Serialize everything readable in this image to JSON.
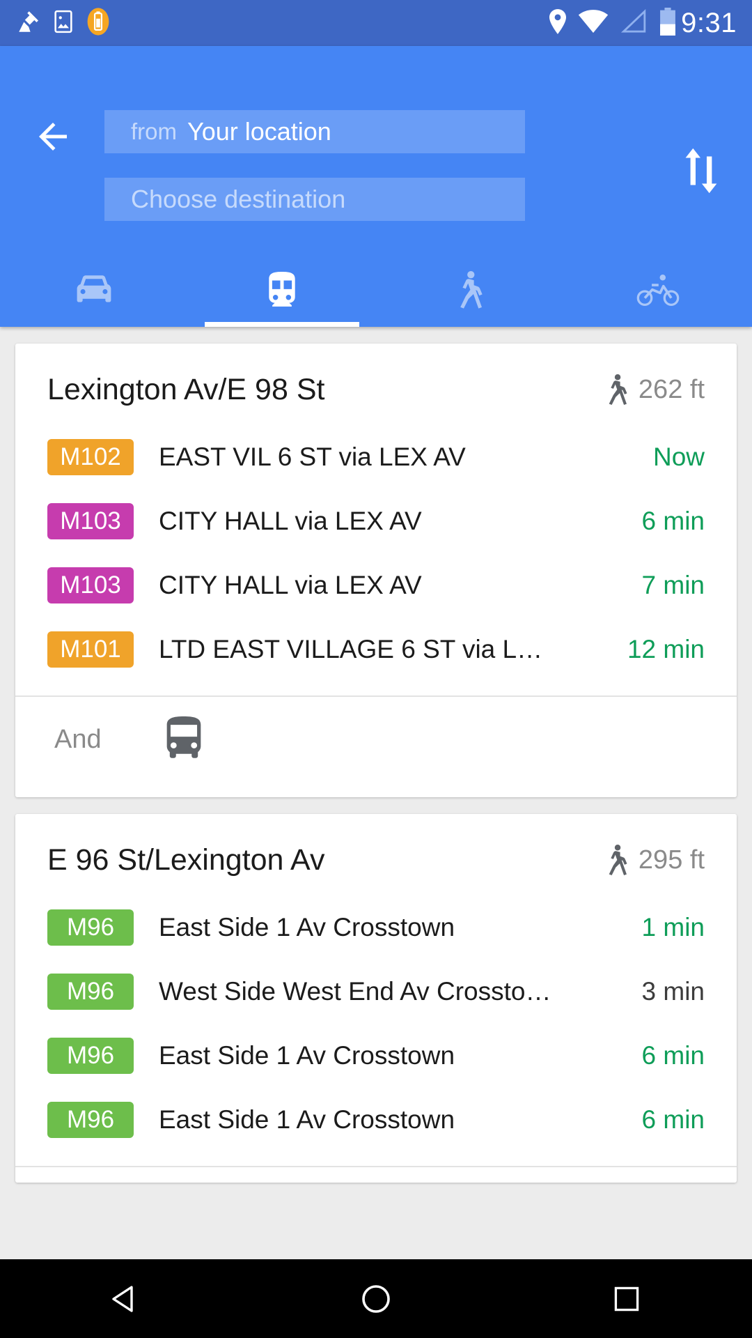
{
  "status_bar": {
    "time": "9:31",
    "left_icons": [
      "cleaner-icon",
      "screenshot-image-icon",
      "battery-saver-icon"
    ],
    "right_icons": [
      "location-pin-icon",
      "wifi-icon",
      "cell-signal-icon",
      "battery-icon"
    ]
  },
  "header": {
    "back_label": "back-arrow",
    "origin": {
      "prefix": "from",
      "value": "Your location"
    },
    "destination": {
      "placeholder": "Choose destination"
    },
    "swap_label": "swap-endpoints",
    "accent_color": "#4585F4",
    "tabs": [
      {
        "id": "driving",
        "icon": "car-icon",
        "active": false
      },
      {
        "id": "transit",
        "icon": "transit-train-icon",
        "active": true
      },
      {
        "id": "walking",
        "icon": "walking-person-icon",
        "active": false
      },
      {
        "id": "cycling",
        "icon": "bicycle-icon",
        "active": false
      }
    ]
  },
  "colors": {
    "badge_orange": "#F0A32A",
    "badge_magenta": "#C63CAE",
    "badge_green": "#6DBE4B",
    "eta_green": "#0E9D58",
    "status_bar": "#3E67C4"
  },
  "cards": [
    {
      "stop_name": "Lexington Av/E 98 St",
      "walk_icon": "walking-person-icon",
      "walk_distance": "262 ft",
      "routes": [
        {
          "badge": "M102",
          "badge_color": "#F0A32A",
          "headsign": "EAST VIL 6 ST via LEX AV",
          "eta": "Now",
          "eta_muted": false
        },
        {
          "badge": "M103",
          "badge_color": "#C63CAE",
          "headsign": "CITY HALL via LEX AV",
          "eta": "6 min",
          "eta_muted": false
        },
        {
          "badge": "M103",
          "badge_color": "#C63CAE",
          "headsign": "CITY HALL via LEX AV",
          "eta": "7 min",
          "eta_muted": false
        },
        {
          "badge": "M101",
          "badge_color": "#F0A32A",
          "headsign": "LTD EAST VILLAGE 6 ST via L…",
          "eta": "12 min",
          "eta_muted": false
        }
      ],
      "and_row": {
        "label": "And",
        "icon": "bus-icon"
      }
    },
    {
      "stop_name": "E 96 St/Lexington Av",
      "walk_icon": "walking-person-icon",
      "walk_distance": "295 ft",
      "routes": [
        {
          "badge": "M96",
          "badge_color": "#6DBE4B",
          "headsign": "East Side 1 Av Crosstown",
          "eta": "1 min",
          "eta_muted": false
        },
        {
          "badge": "M96",
          "badge_color": "#6DBE4B",
          "headsign": "West Side West End Av Crossto…",
          "eta": "3 min",
          "eta_muted": true
        },
        {
          "badge": "M96",
          "badge_color": "#6DBE4B",
          "headsign": "East Side 1 Av Crosstown",
          "eta": "6 min",
          "eta_muted": false
        },
        {
          "badge": "M96",
          "badge_color": "#6DBE4B",
          "headsign": "East Side 1 Av Crosstown",
          "eta": "6 min",
          "eta_muted": false
        }
      ],
      "and_row": null
    }
  ],
  "nav_bar": {
    "buttons": [
      {
        "id": "back",
        "icon": "triangle-back-icon"
      },
      {
        "id": "home",
        "icon": "circle-home-icon"
      },
      {
        "id": "recents",
        "icon": "square-recents-icon"
      }
    ]
  }
}
